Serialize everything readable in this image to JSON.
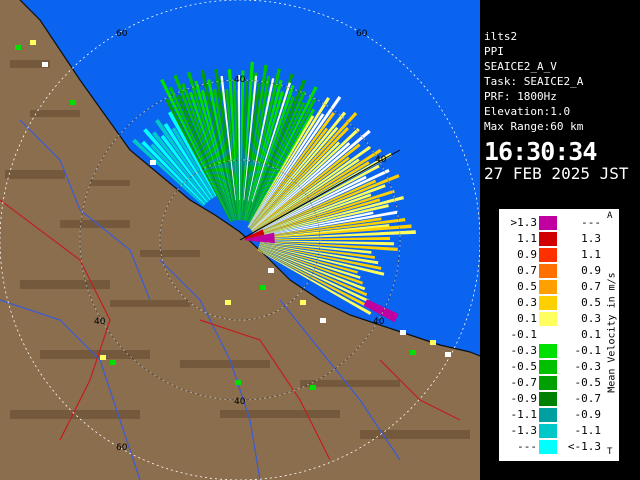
{
  "info": {
    "lines": [
      "ilts2",
      "PPI",
      "SEAICE2_A_V",
      "Task: SEAICE2_A",
      "PRF: 1800Hz",
      "Elevation:1.0",
      "Max Range:60 km"
    ],
    "time": "16:30:34",
    "date": "27 FEB 2025 JST"
  },
  "legend": {
    "title": "Mean Velocity in m/s",
    "top_mark": "A",
    "bottom_mark": "T",
    "rows": [
      {
        "left": ">1.3",
        "right": "---",
        "color": "#c000a0"
      },
      {
        "left": "1.1",
        "right": "1.3",
        "color": "#d00000"
      },
      {
        "left": "0.9",
        "right": "1.1",
        "color": "#ff3000"
      },
      {
        "left": "0.7",
        "right": "0.9",
        "color": "#ff7000"
      },
      {
        "left": "0.5",
        "right": "0.7",
        "color": "#ffa000"
      },
      {
        "left": "0.3",
        "right": "0.5",
        "color": "#ffd000"
      },
      {
        "left": "0.1",
        "right": "0.3",
        "color": "#ffff60"
      },
      {
        "left": "-0.1",
        "right": "0.1",
        "color": "#ffffff"
      },
      {
        "left": "-0.3",
        "right": "-0.1",
        "color": "#00e000"
      },
      {
        "left": "-0.5",
        "right": "-0.3",
        "color": "#00c000"
      },
      {
        "left": "-0.7",
        "right": "-0.5",
        "color": "#00a000"
      },
      {
        "left": "-0.9",
        "right": "-0.7",
        "color": "#008000"
      },
      {
        "left": "-1.1",
        "right": "-0.9",
        "color": "#00a0a0"
      },
      {
        "left": "-1.3",
        "right": "-1.1",
        "color": "#00c8c8"
      },
      {
        "left": "---",
        "right": "<-1.3",
        "color": "#00ffff"
      }
    ]
  },
  "map": {
    "range_labels": [
      "60",
      "60",
      "40",
      "40",
      "40",
      "40",
      "40",
      "60"
    ],
    "colors": {
      "sea": "#0a64f0",
      "land": "#8b6e4e",
      "rings": "#ffffff"
    }
  }
}
